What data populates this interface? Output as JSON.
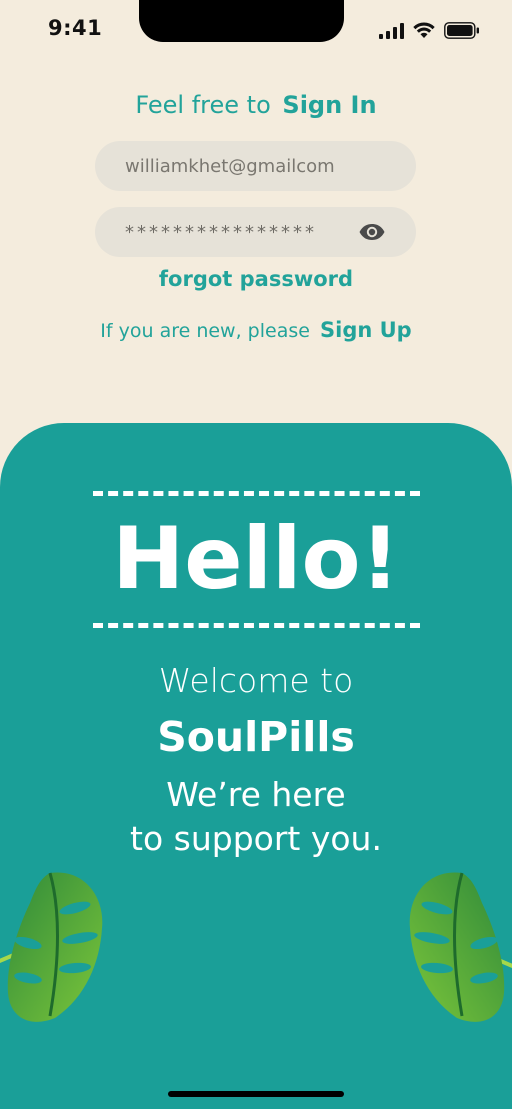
{
  "status_bar": {
    "time": "9:41"
  },
  "signin": {
    "title_prefix": "Feel free to",
    "title_action": "Sign In",
    "email_value": "williamkhet@gmailcom",
    "password_masked": "****************",
    "forgot_label": "forgot password",
    "new_user_text": "If you are new, please",
    "signup_label": "Sign Up"
  },
  "card": {
    "greeting": "Hello!",
    "welcome": "Welcome to",
    "brand": "SoulPills",
    "tagline_1": "We’re here",
    "tagline_2": "to support you."
  },
  "colors": {
    "background": "#f4ecdd",
    "accent": "#22a39a",
    "card": "#1a9f98",
    "field": "#e6e2d8"
  },
  "icons": [
    "signal-icon",
    "wifi-icon",
    "battery-icon",
    "eye-icon",
    "monstera-leaf-icon"
  ]
}
